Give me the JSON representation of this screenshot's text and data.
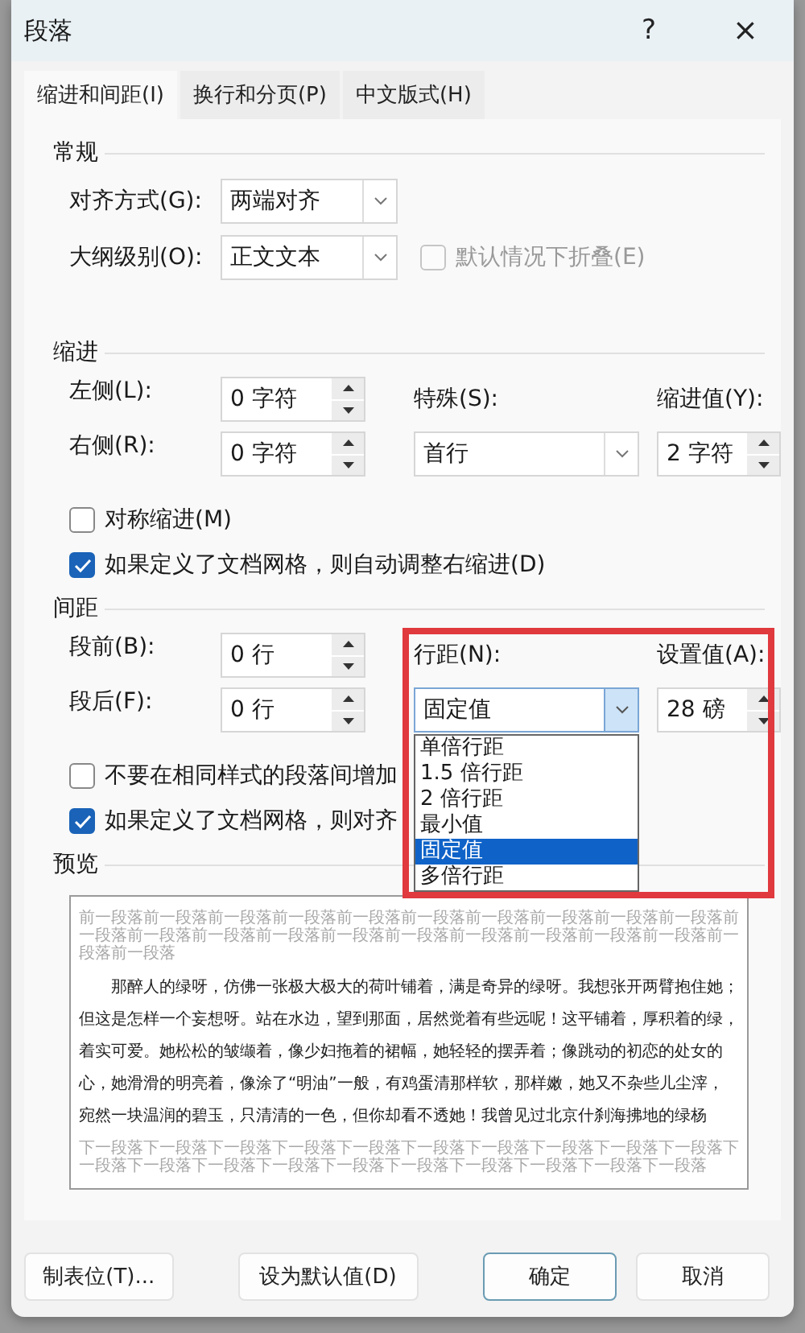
{
  "window": {
    "title": "段落",
    "help": "?",
    "close": "×"
  },
  "tabs": [
    {
      "label": "缩进和间距(I)",
      "selected": true
    },
    {
      "label": "换行和分页(P)",
      "selected": false
    },
    {
      "label": "中文版式(H)",
      "selected": false
    }
  ],
  "general": {
    "heading": "常规",
    "alignment": {
      "label": "对齐方式(G):",
      "value": "两端对齐"
    },
    "outline_level": {
      "label": "大纲级别(O):",
      "value": "正文文本"
    },
    "collapse": {
      "label": "默认情况下折叠(E)",
      "checked": false,
      "disabled": true
    }
  },
  "indentation": {
    "heading": "缩进",
    "left": {
      "label": "左侧(L):",
      "value": "0 字符"
    },
    "right": {
      "label": "右侧(R):",
      "value": "0 字符"
    },
    "special": {
      "label": "特殊(S):",
      "value": "首行",
      "expanded": false
    },
    "by": {
      "label": "缩进值(Y):",
      "value": "2 字符"
    },
    "checks": [
      {
        "label": "对称缩进(M)",
        "checked": false
      },
      {
        "label": "如果定义了文档网格，则自动调整右缩进(D)",
        "checked": true
      }
    ]
  },
  "spacing": {
    "heading": "间距",
    "before": {
      "label": "段前(B):",
      "value": "0 行"
    },
    "after": {
      "label": "段后(F):",
      "value": "0 行"
    },
    "line_spacing": {
      "label": "行距(N):",
      "value": "固定值",
      "expanded": true,
      "options": [
        {
          "label": "单倍行距",
          "selected": false
        },
        {
          "label": "1.5 倍行距",
          "selected": false
        },
        {
          "label": "2 倍行距",
          "selected": false
        },
        {
          "label": "最小值",
          "selected": false
        },
        {
          "label": "固定值",
          "selected": true
        },
        {
          "label": "多倍行距",
          "selected": false
        }
      ]
    },
    "at": {
      "label": "设置值(A):",
      "value": "28 磅"
    },
    "checks": [
      {
        "label": "不要在相同样式的段落间增加",
        "checked": false
      },
      {
        "label": "如果定义了文档网格，则对齐",
        "checked": true
      }
    ],
    "highlighted": true
  },
  "preview": {
    "heading": "预览",
    "previous": "前一段落前一段落前一段落前一段落前一段落前一段落前一段落前一段落前一段落前一段落前一段落前一段落前一段落前一段落前一段落前一段落前一段落前一段落前一段落前一段落前一段落前一段落",
    "body": "那醉人的绿呀，仿佛一张极大极大的荷叶铺着，满是奇异的绿呀。我想张开两臂抱住她；但这是怎样一个妄想呀。站在水边，望到那面，居然觉着有些远呢！这平铺着，厚积着的绿，着实可爱。她松松的皱缬着，像少妇拖着的裙幅，她轻轻的摆弄着；像跳动的初恋的处女的心，她滑滑的明亮着，像涂了“明油”一般，有鸡蛋清那样软，那样嫩，她又不杂些儿尘滓，宛然一块温润的碧玉，只清清的一色，但你却看不透她！我曾见过北京什刹海拂地的绿杨",
    "next": "下一段落下一段落下一段落下一段落下一段落下一段落下一段落下一段落下一段落下一段落下一段落下一段落下一段落下一段落下一段落下一段落下一段落下一段落下一段落下一段落"
  },
  "buttons": [
    {
      "label": "制表位(T)...",
      "default": false
    },
    {
      "label": "设为默认值(D)",
      "default": false
    },
    {
      "label": "确定",
      "default": true
    },
    {
      "label": "取消",
      "default": false
    }
  ]
}
